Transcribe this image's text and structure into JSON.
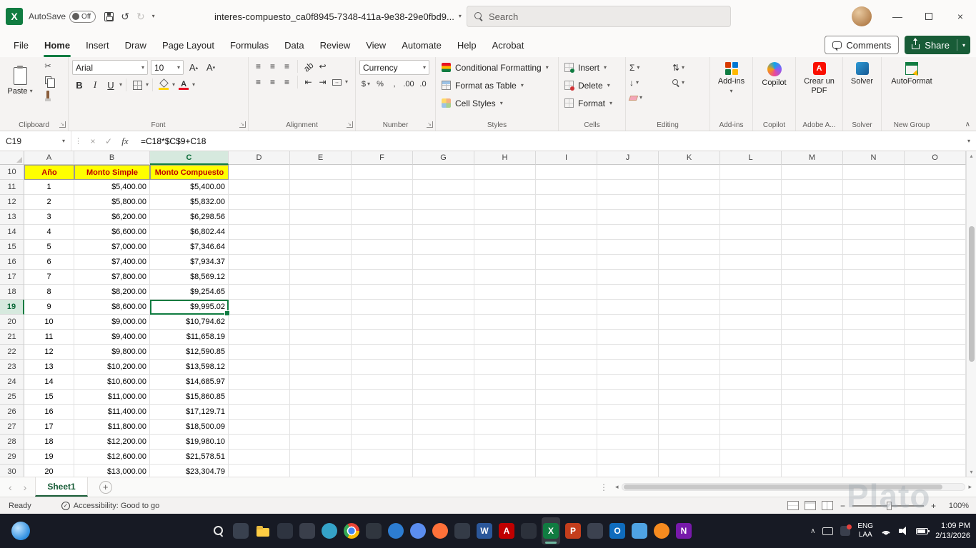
{
  "icons": {
    "excel_glyph": "X",
    "adobe_glyph": "A",
    "chevron_down": "▾",
    "chevron_up": "∧",
    "undo": "↺",
    "redo": "↻",
    "cut": "✂",
    "bold": "B",
    "italic": "I",
    "underline": "U",
    "font_color_a": "A",
    "align_lines": "≡",
    "rotate_ab": "ab",
    "wrap": "↩",
    "indent_left": "⇤",
    "indent_right": "⇥",
    "merge_arrows": "↔",
    "dollar": "$",
    "percent": "%",
    "comma": ",",
    "dec_less": ".0",
    "dec_more": ".00",
    "sum": "Σ",
    "fill_down": "↓",
    "sort": "⇅",
    "cancel": "×",
    "enter": "✓",
    "fx": "fx",
    "grip": "⋮",
    "tab_prev": "‹",
    "tab_next": "›",
    "add_sheet": "+",
    "scroll_up": "▴",
    "scroll_down": "▾",
    "scroll_left": "◂",
    "scroll_right": "▸",
    "minimize": "—",
    "close": "×",
    "minus": "−",
    "plus": "+"
  },
  "title_bar": {
    "autosave_label": "AutoSave",
    "autosave_state": "Off",
    "filename": "interes-compuesto_ca0f8945-7348-411a-9e38-29e0fbd9...",
    "search_placeholder": "Search"
  },
  "menu_bar": {
    "tabs": [
      "File",
      "Home",
      "Insert",
      "Draw",
      "Page Layout",
      "Formulas",
      "Data",
      "Review",
      "View",
      "Automate",
      "Help",
      "Acrobat"
    ],
    "active": "Home",
    "comments": "Comments",
    "share": "Share"
  },
  "ribbon": {
    "clipboard": {
      "label": "Clipboard",
      "paste": "Paste"
    },
    "font": {
      "label": "Font",
      "name": "Arial",
      "size": "10"
    },
    "alignment": {
      "label": "Alignment"
    },
    "number": {
      "label": "Number",
      "format": "Currency"
    },
    "styles": {
      "label": "Styles",
      "items": [
        "Conditional Formatting",
        "Format as Table",
        "Cell Styles"
      ]
    },
    "cells": {
      "label": "Cells",
      "items": [
        "Insert",
        "Delete",
        "Format"
      ]
    },
    "editing": {
      "label": "Editing"
    },
    "addins": {
      "label": "Add-ins",
      "button": "Add-ins"
    },
    "copilot": {
      "label": "Copilot",
      "button": "Copilot"
    },
    "adobe": {
      "label": "Adobe A...",
      "button": "Crear un PDF"
    },
    "solver": {
      "label": "Solver",
      "button": "Solver"
    },
    "newgroup": {
      "label": "New Group",
      "button": "AutoFormat"
    }
  },
  "formula_bar": {
    "name_box": "C19",
    "formula": "=C18*$C$9+C18"
  },
  "grid": {
    "columns": [
      "A",
      "B",
      "C",
      "D",
      "E",
      "F",
      "G",
      "H",
      "I",
      "J",
      "K",
      "L",
      "M",
      "N",
      "O"
    ],
    "selected": {
      "cell": "C19",
      "col": "C",
      "row": 19
    },
    "header_row": {
      "row": 10,
      "labels": [
        "Año",
        "Monto Simple",
        "Monto Compuesto"
      ]
    },
    "rows": [
      {
        "r": 11,
        "a": "1",
        "b": "$5,400.00",
        "c": "$5,400.00"
      },
      {
        "r": 12,
        "a": "2",
        "b": "$5,800.00",
        "c": "$5,832.00"
      },
      {
        "r": 13,
        "a": "3",
        "b": "$6,200.00",
        "c": "$6,298.56"
      },
      {
        "r": 14,
        "a": "4",
        "b": "$6,600.00",
        "c": "$6,802.44"
      },
      {
        "r": 15,
        "a": "5",
        "b": "$7,000.00",
        "c": "$7,346.64"
      },
      {
        "r": 16,
        "a": "6",
        "b": "$7,400.00",
        "c": "$7,934.37"
      },
      {
        "r": 17,
        "a": "7",
        "b": "$7,800.00",
        "c": "$8,569.12"
      },
      {
        "r": 18,
        "a": "8",
        "b": "$8,200.00",
        "c": "$9,254.65"
      },
      {
        "r": 19,
        "a": "9",
        "b": "$8,600.00",
        "c": "$9,995.02"
      },
      {
        "r": 20,
        "a": "10",
        "b": "$9,000.00",
        "c": "$10,794.62"
      },
      {
        "r": 21,
        "a": "11",
        "b": "$9,400.00",
        "c": "$11,658.19"
      },
      {
        "r": 22,
        "a": "12",
        "b": "$9,800.00",
        "c": "$12,590.85"
      },
      {
        "r": 23,
        "a": "13",
        "b": "$10,200.00",
        "c": "$13,598.12"
      },
      {
        "r": 24,
        "a": "14",
        "b": "$10,600.00",
        "c": "$14,685.97"
      },
      {
        "r": 25,
        "a": "15",
        "b": "$11,000.00",
        "c": "$15,860.85"
      },
      {
        "r": 26,
        "a": "16",
        "b": "$11,400.00",
        "c": "$17,129.71"
      },
      {
        "r": 27,
        "a": "17",
        "b": "$11,800.00",
        "c": "$18,500.09"
      },
      {
        "r": 28,
        "a": "18",
        "b": "$12,200.00",
        "c": "$19,980.10"
      },
      {
        "r": 29,
        "a": "19",
        "b": "$12,600.00",
        "c": "$21,578.51"
      },
      {
        "r": 30,
        "a": "20",
        "b": "$13,000.00",
        "c": "$23,304.79"
      }
    ]
  },
  "sheet_bar": {
    "tabs": [
      "Sheet1"
    ],
    "active": "Sheet1"
  },
  "status_bar": {
    "mode": "Ready",
    "accessibility": "Accessibility: Good to go",
    "zoom": "100%"
  },
  "taskbar": {
    "icons": [
      {
        "name": "start",
        "kind": "start"
      },
      {
        "name": "search",
        "kind": "search"
      },
      {
        "name": "task-view",
        "kind": "square",
        "color": "#39414F"
      },
      {
        "name": "file-explorer",
        "kind": "folder"
      },
      {
        "name": "app-dark-1",
        "kind": "square",
        "color": "#2E3440"
      },
      {
        "name": "app-dark-2",
        "kind": "square",
        "color": "#3A3F4B"
      },
      {
        "name": "edge",
        "kind": "circle",
        "color": "#35A3C8"
      },
      {
        "name": "chrome",
        "kind": "chrome"
      },
      {
        "name": "app-dark-3",
        "kind": "square",
        "color": "#30363F"
      },
      {
        "name": "store",
        "kind": "circle",
        "color": "#2D7DD2"
      },
      {
        "name": "photos",
        "kind": "circle",
        "color": "#5B8DEF"
      },
      {
        "name": "firefox",
        "kind": "circle",
        "color": "#FF7139"
      },
      {
        "name": "app-dark-4",
        "kind": "square",
        "color": "#343B47"
      },
      {
        "name": "word",
        "kind": "letter",
        "glyph": "W",
        "color": "#2B579A"
      },
      {
        "name": "acrobat",
        "kind": "letter",
        "glyph": "A",
        "color": "#C00000"
      },
      {
        "name": "app-dark-5",
        "kind": "square",
        "color": "#2C313B"
      },
      {
        "name": "excel",
        "kind": "letter",
        "glyph": "X",
        "color": "#107C41",
        "active": true
      },
      {
        "name": "powerpoint",
        "kind": "letter",
        "glyph": "P",
        "color": "#C43E1C"
      },
      {
        "name": "app-dark-6",
        "kind": "square",
        "color": "#3C4250"
      },
      {
        "name": "outlook",
        "kind": "letter",
        "glyph": "O",
        "color": "#0F6CBD"
      },
      {
        "name": "mail",
        "kind": "square",
        "color": "#4FA3E3"
      },
      {
        "name": "browser-orange",
        "kind": "circle",
        "color": "#F68B1F"
      },
      {
        "name": "onenote",
        "kind": "letter",
        "glyph": "N",
        "color": "#7719AA"
      }
    ],
    "tray": {
      "lang1": "ENG",
      "lang2": "LAA",
      "time": "1:09 PM",
      "date": "2/13/2026"
    }
  },
  "watermark": "Plato"
}
